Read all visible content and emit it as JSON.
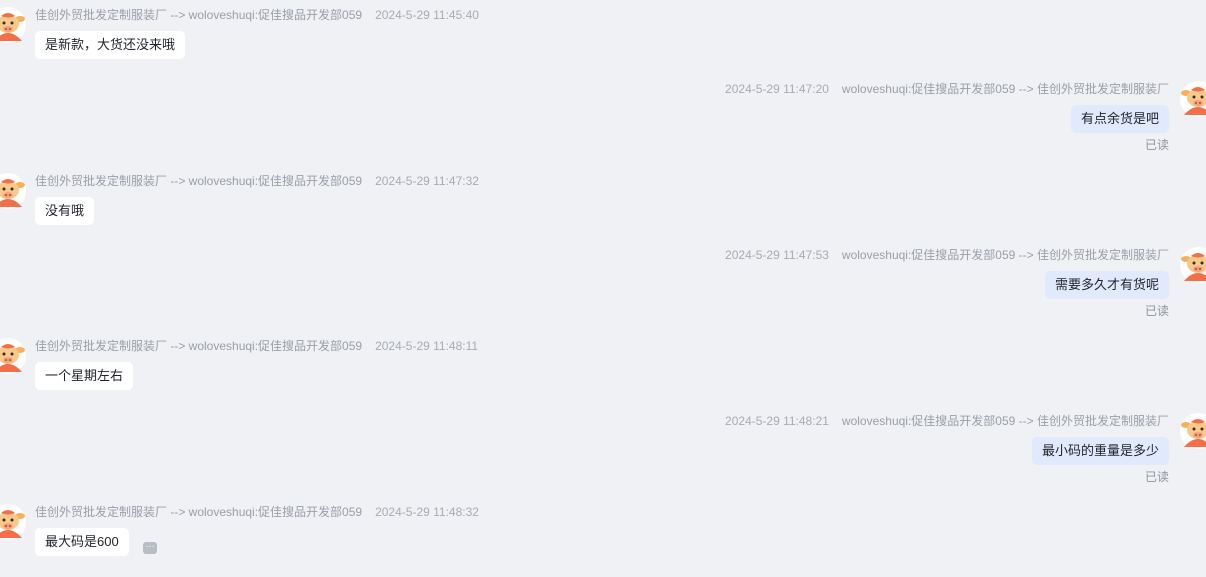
{
  "messages": [
    {
      "direction": "in",
      "sender": "佳创外贸批发定制服装厂 --> woloveshuqi:促佳搜品开发部059",
      "time": "2024-5-29 11:45:40",
      "text": "是新款，大货还没来哦"
    },
    {
      "direction": "out",
      "sender": "woloveshuqi:促佳搜品开发部059 --> 佳创外贸批发定制服装厂",
      "time": "2024-5-29 11:47:20",
      "text": "有点余货是吧",
      "status": "已读"
    },
    {
      "direction": "in",
      "sender": "佳创外贸批发定制服装厂 --> woloveshuqi:促佳搜品开发部059",
      "time": "2024-5-29 11:47:32",
      "text": "没有哦"
    },
    {
      "direction": "out",
      "sender": "woloveshuqi:促佳搜品开发部059 --> 佳创外贸批发定制服装厂",
      "time": "2024-5-29 11:47:53",
      "text": "需要多久才有货呢",
      "status": "已读"
    },
    {
      "direction": "in",
      "sender": "佳创外贸批发定制服装厂 --> woloveshuqi:促佳搜品开发部059",
      "time": "2024-5-29 11:48:11",
      "text": "一个星期左右"
    },
    {
      "direction": "out",
      "sender": "woloveshuqi:促佳搜品开发部059 --> 佳创外贸批发定制服装厂",
      "time": "2024-5-29 11:48:21",
      "text": "最小码的重量是多少",
      "status": "已读"
    },
    {
      "direction": "in",
      "sender": "佳创外贸批发定制服装厂 --> woloveshuqi:促佳搜品开发部059",
      "time": "2024-5-29 11:48:32",
      "text": "最大码是600",
      "has_more_button": true
    }
  ],
  "more_button_label": "···",
  "colors": {
    "background": "#eff1f5",
    "incoming_bubble": "#ffffff",
    "outgoing_bubble": "#e1e9fc",
    "avatar_body": "#f36f4a",
    "avatar_face": "#f9c98c"
  }
}
